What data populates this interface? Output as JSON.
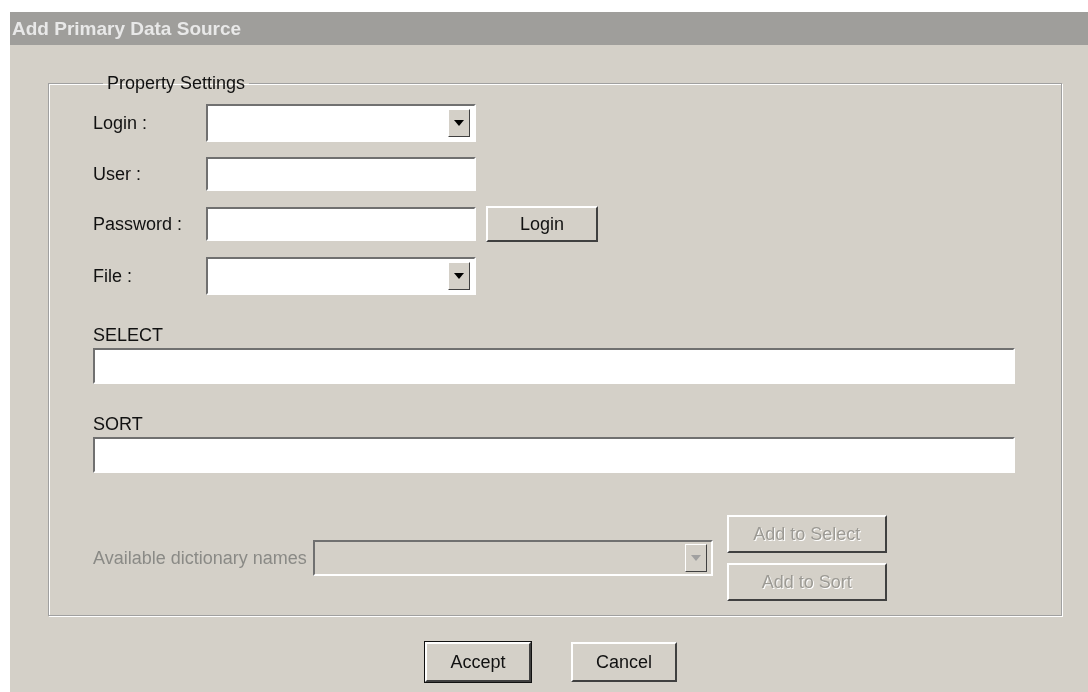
{
  "window": {
    "title": "Add Primary Data Source"
  },
  "group": {
    "legend": "Property Settings",
    "fields": [
      {
        "kind": "combo",
        "label": "Login :"
      },
      {
        "kind": "text",
        "label": "User :"
      },
      {
        "kind": "text",
        "label": "Password :",
        "button": "Login"
      },
      {
        "kind": "combo",
        "label": "File :"
      }
    ],
    "queries": [
      {
        "label": "SELECT"
      },
      {
        "label": "SORT"
      }
    ],
    "dictionary": {
      "label": "Available dictionary names",
      "disabled": true,
      "buttons": [
        {
          "label": "Add to Select",
          "disabled": true
        },
        {
          "label": "Add to Sort",
          "disabled": true
        }
      ]
    }
  },
  "buttons": [
    {
      "label": "Accept",
      "default": true
    },
    {
      "label": "Cancel",
      "default": false
    }
  ]
}
